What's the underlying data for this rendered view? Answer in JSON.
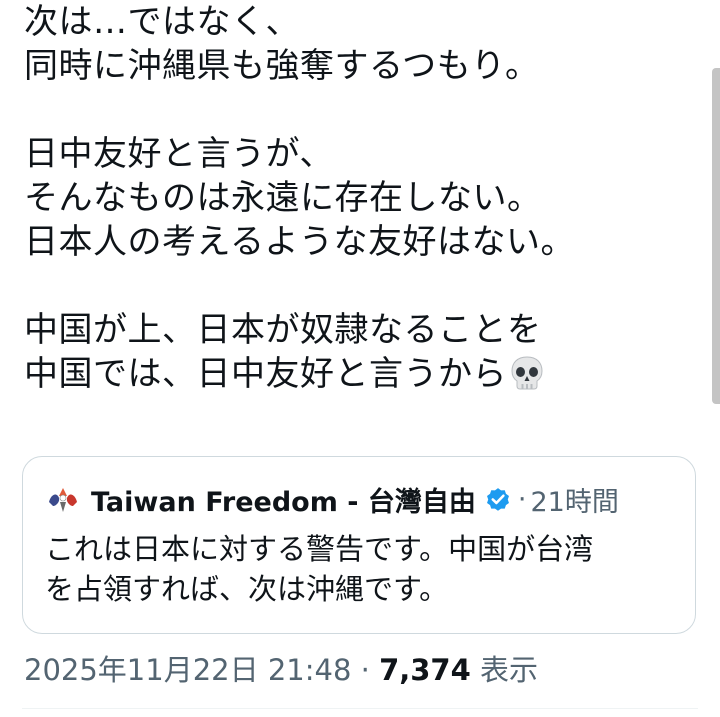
{
  "tweet": {
    "lines": [
      "次は…ではなく、",
      "同時に沖縄県も強奪するつもり。",
      "",
      "日中友好と言うが、",
      "そんなものは永遠に存在しない。",
      "日本人の考えるような友好はない。",
      "",
      "中国が上、日本が奴隷なることを",
      "中国では、日中友好と言うから"
    ],
    "trailing_emoji": "skull-icon"
  },
  "quote": {
    "author_name": "Taiwan Freedom - 台灣自由",
    "verified": true,
    "verified_color": "#1d9bf0",
    "separator": "·",
    "time_ago": "21時間",
    "text_lines": [
      "これは日本に対する警告です。中国が台湾",
      "を占領すれば、次は沖縄です。"
    ]
  },
  "meta": {
    "timestamp": "2025年11月22日 21:48",
    "separator": "·",
    "views_count": "7,374",
    "views_label": "表示"
  },
  "colors": {
    "text": "#0f1419",
    "secondary": "#536471",
    "border": "#cfd9de"
  }
}
